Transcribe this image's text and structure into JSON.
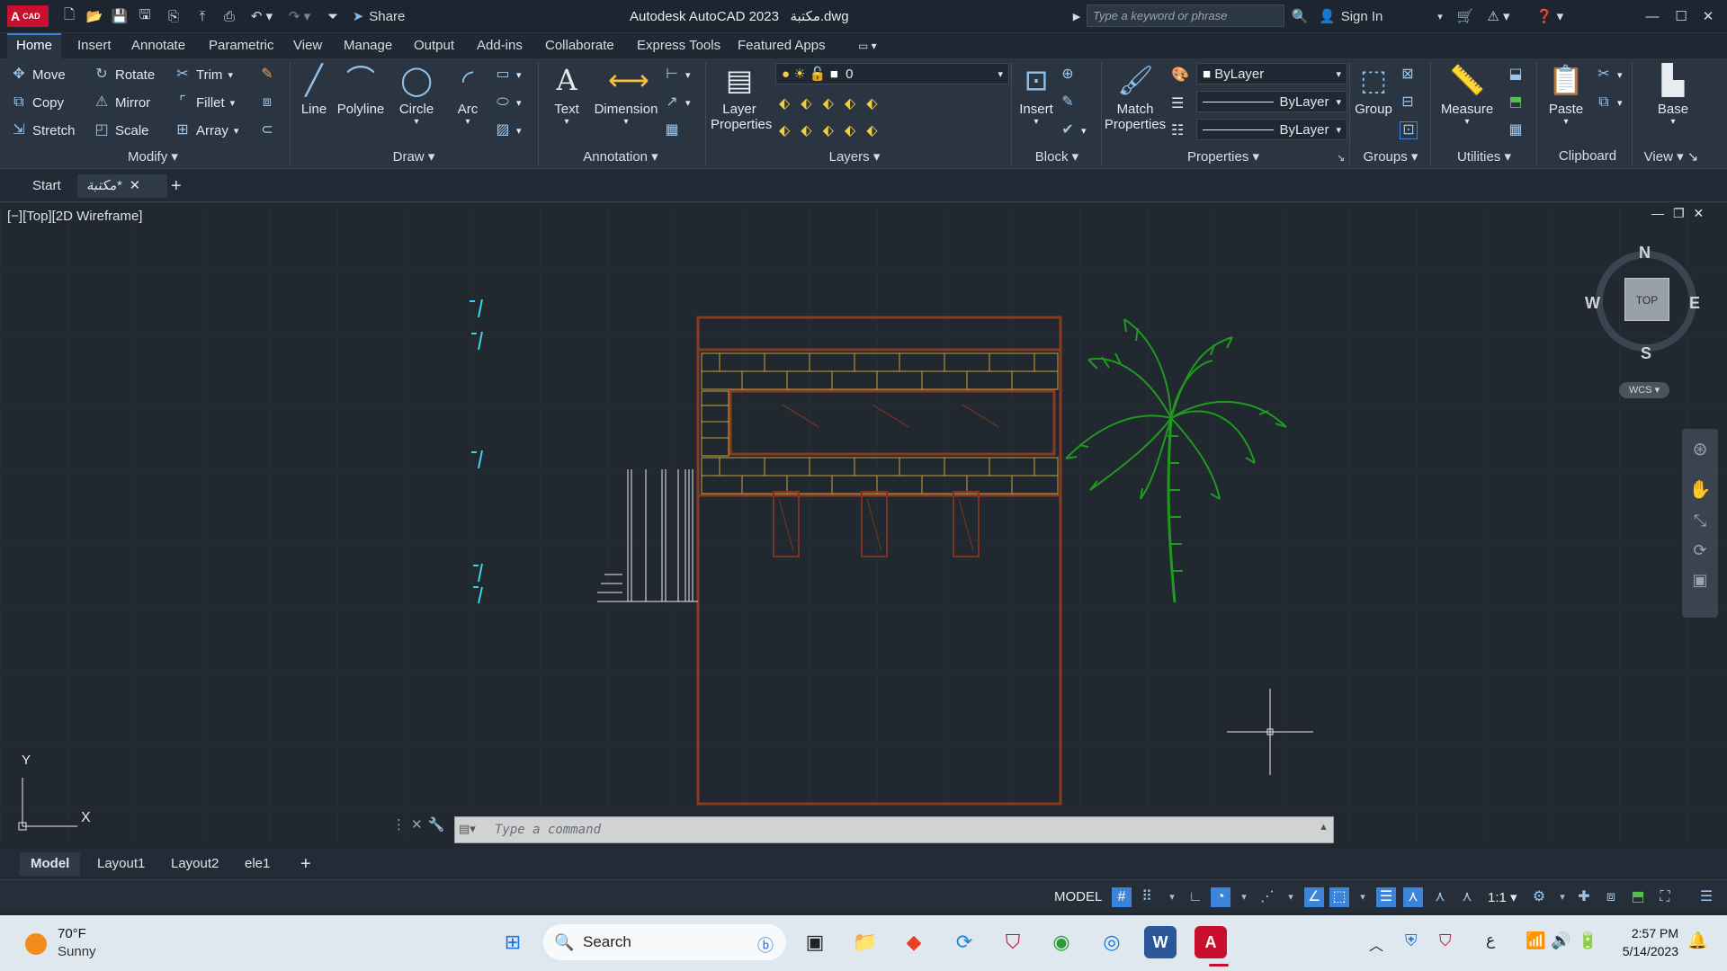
{
  "app": {
    "title": "Autodesk AutoCAD 2023",
    "filename": "مكتبة.dwg",
    "logo": "A",
    "logo_small": "CAD",
    "share": "Share",
    "search_placeholder": "Type a keyword or phrase",
    "sign_in": "Sign In"
  },
  "ribbon_tabs": [
    "Home",
    "Insert",
    "Annotate",
    "Parametric",
    "View",
    "Manage",
    "Output",
    "Add-ins",
    "Collaborate",
    "Express Tools",
    "Featured Apps"
  ],
  "modify": {
    "title": "Modify",
    "move": "Move",
    "rotate": "Rotate",
    "trim": "Trim",
    "copy": "Copy",
    "mirror": "Mirror",
    "fillet": "Fillet",
    "stretch": "Stretch",
    "scale": "Scale",
    "array": "Array"
  },
  "draw": {
    "title": "Draw",
    "line": "Line",
    "polyline": "Polyline",
    "circle": "Circle",
    "arc": "Arc"
  },
  "annotation": {
    "title": "Annotation",
    "text": "Text",
    "dimension": "Dimension"
  },
  "layers": {
    "title": "Layers",
    "layer_properties_1": "Layer",
    "layer_properties_2": "Properties",
    "current_layer": "0"
  },
  "block": {
    "title": "Block",
    "insert": "Insert"
  },
  "properties": {
    "title": "Properties",
    "match_1": "Match",
    "match_2": "Properties",
    "color": "ByLayer",
    "linetype": "ByLayer",
    "lineweight": "ByLayer"
  },
  "groups": {
    "title": "Groups",
    "group": "Group"
  },
  "utilities": {
    "title": "Utilities",
    "measure": "Measure"
  },
  "clipboard": {
    "title": "Clipboard",
    "paste": "Paste"
  },
  "view_panel": {
    "title": "View",
    "base": "Base"
  },
  "file_tabs": {
    "start": "Start",
    "active": "مكتبة*"
  },
  "viewport": {
    "label": "[−][Top][2D Wireframe]",
    "top": "TOP",
    "n": "N",
    "s": "S",
    "e": "E",
    "w": "W",
    "wcs": "WCS",
    "y_axis": "Y",
    "x_axis": "X"
  },
  "command": {
    "placeholder": "Type a command"
  },
  "layout_tabs": [
    "Model",
    "Layout1",
    "Layout2",
    "ele1"
  ],
  "status": {
    "model": "MODEL",
    "scale": "1:1"
  },
  "taskbar": {
    "temp": "70°F",
    "weather": "Sunny",
    "search": "Search",
    "time": "2:57 PM",
    "date": "5/14/2023",
    "lang": "ع"
  },
  "colors": {
    "accent": "#3b84d8",
    "bg": "#212830",
    "brick": "#8a3a22",
    "brick_line": "#c8a23c",
    "palm": "#1f9a1f",
    "cyan_marks": "#35d6e8"
  }
}
